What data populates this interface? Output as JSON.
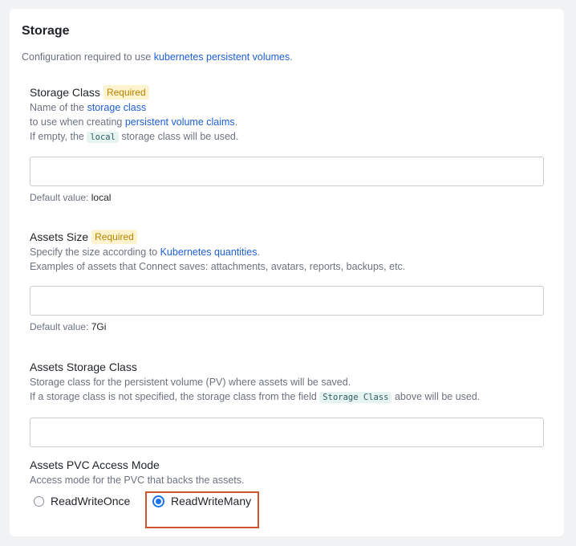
{
  "section": {
    "title": "Storage",
    "desc_prefix": "Configuration required to use ",
    "desc_link": "kubernetes persistent volumes",
    "desc_suffix": "."
  },
  "storage_class": {
    "label": "Storage Class",
    "badge": "Required",
    "help1_prefix": "Name of the ",
    "help1_link": "storage class",
    "help2_prefix": "to use when creating ",
    "help2_link": "persistent volume claims",
    "help2_suffix": ".",
    "help3_prefix": "If empty, the ",
    "help3_code": "local",
    "help3_suffix": " storage class will be used.",
    "value": "",
    "default_label": "Default value:",
    "default_value": "local"
  },
  "assets_size": {
    "label": "Assets Size",
    "badge": "Required",
    "help1_prefix": "Specify the size according to ",
    "help1_link": "Kubernetes quantities",
    "help1_suffix": ".",
    "help2": "Examples of assets that Connect saves: attachments, avatars, reports, backups, etc.",
    "value": "",
    "default_label": "Default value:",
    "default_value": "7Gi"
  },
  "assets_storage_class": {
    "label": "Assets Storage Class",
    "help1": "Storage class for the persistent volume (PV) where assets will be saved.",
    "help2_prefix": "If a storage class is not specified, the storage class from the field ",
    "help2_code": "Storage Class",
    "help2_suffix": " above will be used.",
    "value": ""
  },
  "access_mode": {
    "label": "Assets PVC Access Mode",
    "help": "Access mode for the PVC that backs the assets.",
    "options": [
      {
        "label": "ReadWriteOnce",
        "checked": false
      },
      {
        "label": "ReadWriteMany",
        "checked": true
      }
    ]
  },
  "colors": {
    "link": "#1d5fd6",
    "badge_bg": "#fdf3cf",
    "badge_text": "#b88300",
    "radio_accent": "#1a73e8",
    "highlight_border": "#d0532c"
  }
}
